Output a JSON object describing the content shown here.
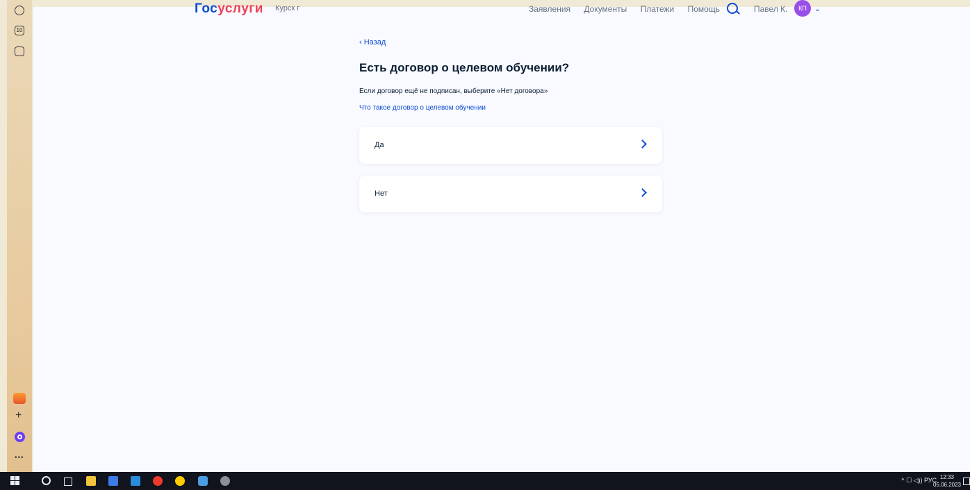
{
  "header": {
    "logo_part1": "Гос",
    "logo_part2": "услуги",
    "region": "Курск г",
    "nav": [
      "Заявления",
      "Документы",
      "Платежи",
      "Помощь"
    ],
    "user_name": "Павел К.",
    "avatar_initials": "КП"
  },
  "main": {
    "back_label": "‹ Назад",
    "title": "Есть договор о целевом обучении?",
    "hint": "Если договор ещё не подписан, выберите «Нет договора»",
    "info_link": "Что такое договор о целевом обучении",
    "options": [
      {
        "label": "Да"
      },
      {
        "label": "Нет"
      }
    ]
  },
  "sidebar": {
    "ten_label": "10",
    "plus_label": "+",
    "more_label": "•••"
  },
  "taskbar": {
    "tray": "^  ☐  ◁)) РУС",
    "time": "12:33",
    "date": "05.06.2023"
  },
  "colors": {
    "brand_blue": "#0d4cd3",
    "brand_red": "#ee3f58",
    "page_bg": "#f9faff",
    "taskbar_bg": "#11141c"
  },
  "icons": [
    "play-icon",
    "ten-icon",
    "eye-icon",
    "mail-icon",
    "plus-icon",
    "alice-icon",
    "more-icon",
    "search-icon",
    "chevron-down-icon",
    "chevron-right-icon",
    "windows-start-icon"
  ]
}
